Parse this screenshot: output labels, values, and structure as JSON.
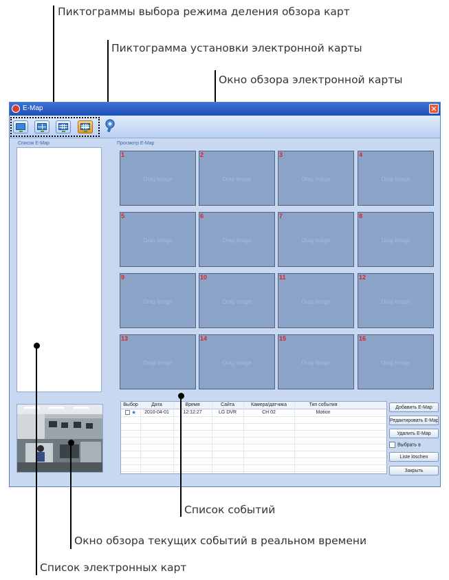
{
  "annotations": {
    "mode_icons": "Пиктограммы выбора режима деления обзора карт",
    "setup_icon": "Пиктограмма установки электронной карты",
    "view_window": "Окно обзора электронной карты",
    "event_list": "Список событий",
    "live_view": "Окно обзора текущих событий в реальном времени",
    "map_list": "Список электронных карт"
  },
  "window": {
    "title": "E-Map",
    "close_label": "✕"
  },
  "panels": {
    "map_list_label": "Список E-Map",
    "map_view_label": "Просмотр E-Map"
  },
  "map_cells": [
    {
      "num": "1",
      "text": "Drag Image"
    },
    {
      "num": "2",
      "text": "Drag Image"
    },
    {
      "num": "3",
      "text": "Drag Image"
    },
    {
      "num": "4",
      "text": "Drag Image"
    },
    {
      "num": "5",
      "text": "Drag Image"
    },
    {
      "num": "6",
      "text": "Drag Image"
    },
    {
      "num": "7",
      "text": "Drag Image"
    },
    {
      "num": "8",
      "text": "Drag Image"
    },
    {
      "num": "9",
      "text": "Drag Image"
    },
    {
      "num": "10",
      "text": "Drag Image"
    },
    {
      "num": "11",
      "text": "Drag Image"
    },
    {
      "num": "12",
      "text": "Drag Image"
    },
    {
      "num": "13",
      "text": "Drag Image"
    },
    {
      "num": "14",
      "text": "Drag Image"
    },
    {
      "num": "15",
      "text": "Drag Image"
    },
    {
      "num": "16",
      "text": "Drag Image"
    }
  ],
  "events": {
    "headers": [
      "Выбор",
      "Дата",
      "Время",
      "Сайта",
      "Камера/датчика",
      "Тип события"
    ],
    "rows": [
      [
        "",
        "2010-04-01",
        "12:12:27",
        "LG DVR",
        "CH 02",
        "Motion"
      ]
    ]
  },
  "buttons": {
    "add": "Добавить E-Map",
    "edit": "Редактировать E-Map",
    "delete": "Удалить E-Map",
    "select_all": "Выбрать в",
    "clear_list": "Liste löschen",
    "close": "Закрыть"
  },
  "colors": {
    "accent": "#2f76c8",
    "active_mode": "#e8951e",
    "cell_number": "#e02020"
  }
}
